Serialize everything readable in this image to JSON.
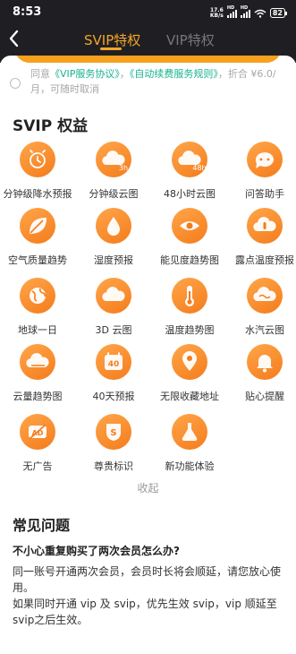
{
  "status_bar": {
    "time": "8:53",
    "net_speed_value": "17.6",
    "net_speed_unit": "KB/s",
    "signal_tags": [
      "HD",
      "HD"
    ],
    "battery": "82"
  },
  "header": {
    "tabs": [
      {
        "label": "SVIP特权",
        "active": true
      },
      {
        "label": "VIP特权",
        "active": false
      }
    ]
  },
  "agreement": {
    "prefix": "同意",
    "link1": "《VIP服务协议》",
    "sep": "，",
    "link2": "《自动续费服务规则》",
    "suffix": "，折合 ¥6.0/月，可随时取消",
    "link_color": "#18b28f"
  },
  "benefits": {
    "title": "SVIP 权益",
    "items": [
      {
        "label": "分钟级降水预报",
        "icon": "clock-rain-icon"
      },
      {
        "label": "分钟级云图",
        "icon": "cloud-3h-icon",
        "badge": "3h"
      },
      {
        "label": "48小时云图",
        "icon": "cloud-48h-icon",
        "badge": "48h"
      },
      {
        "label": "问答助手",
        "icon": "chat-bubble-icon"
      },
      {
        "label": "空气质量趋势",
        "icon": "leaf-icon"
      },
      {
        "label": "湿度预报",
        "icon": "droplet-icon"
      },
      {
        "label": "能见度趋势图",
        "icon": "eye-icon"
      },
      {
        "label": "露点温度预报",
        "icon": "cloud-thermometer-icon"
      },
      {
        "label": "地球一日",
        "icon": "globe-icon"
      },
      {
        "label": "3D 云图",
        "icon": "cloud-icon"
      },
      {
        "label": "温度趋势图",
        "icon": "thermometer-icon"
      },
      {
        "label": "水汽云图",
        "icon": "vapor-cloud-icon"
      },
      {
        "label": "云量趋势图",
        "icon": "cloud-cover-icon"
      },
      {
        "label": "40天预报",
        "icon": "calendar-40-icon",
        "badge": "40"
      },
      {
        "label": "无限收藏地址",
        "icon": "location-pin-icon"
      },
      {
        "label": "贴心提醒",
        "icon": "bell-icon"
      },
      {
        "label": "无广告",
        "icon": "no-ad-icon",
        "badge": "AD"
      },
      {
        "label": "尊贵标识",
        "icon": "crown-badge-icon",
        "badge": "S"
      },
      {
        "label": "新功能体验",
        "icon": "flask-icon"
      }
    ],
    "collapse_label": "收起"
  },
  "faq": {
    "title": "常见问题",
    "question": "不小心重复购买了两次会员怎么办?",
    "answers": [
      "同一账号开通两次会员，会员时长将会顺延，请您放心使用。",
      "如果同时开通 vip 及 svip，优先生效 svip，vip 顺延至 svip之后生效。"
    ]
  },
  "colors": {
    "accent": "#f4a52a",
    "icon_gradient_start": "#ffa64a",
    "icon_gradient_end": "#f47c1c",
    "header_bg": "#1f1f23"
  }
}
